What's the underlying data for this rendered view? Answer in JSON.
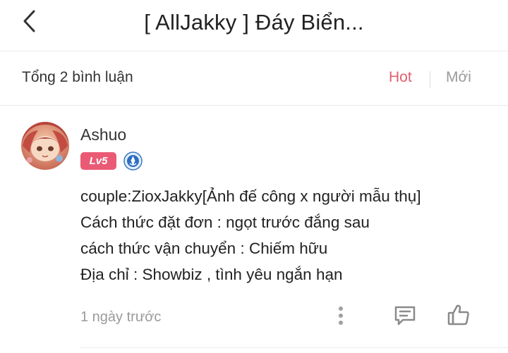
{
  "header": {
    "back_icon": "chevron-left-icon",
    "title": "[ AllJakky ] Đáy Biển..."
  },
  "comments_bar": {
    "total_label": "Tổng 2 bình luận",
    "sort_hot": "Hot",
    "sort_new": "Mới",
    "active_sort": "Hot",
    "accent_color": "#e45d6f"
  },
  "comment": {
    "avatar_icon": "user-avatar",
    "username": "Ashuo",
    "level": "Lv5",
    "level_color": "#ea5a74",
    "rank_icon": "blue-rank-badge-icon",
    "lines": [
      "couple:ZioxJakky[Ảnh đế công x người mẫu thụ]",
      "Cách thức đặt đơn : ngọt trước đắng sau",
      "cách thức vận chuyển : Chiếm hữu",
      "Địa chỉ : Showbiz ,  tình yêu ngắn hạn"
    ],
    "time": "1 ngày trước",
    "more_icon": "more-vertical-icon",
    "reply_icon": "comment-reply-icon",
    "like_icon": "thumbs-up-icon"
  }
}
